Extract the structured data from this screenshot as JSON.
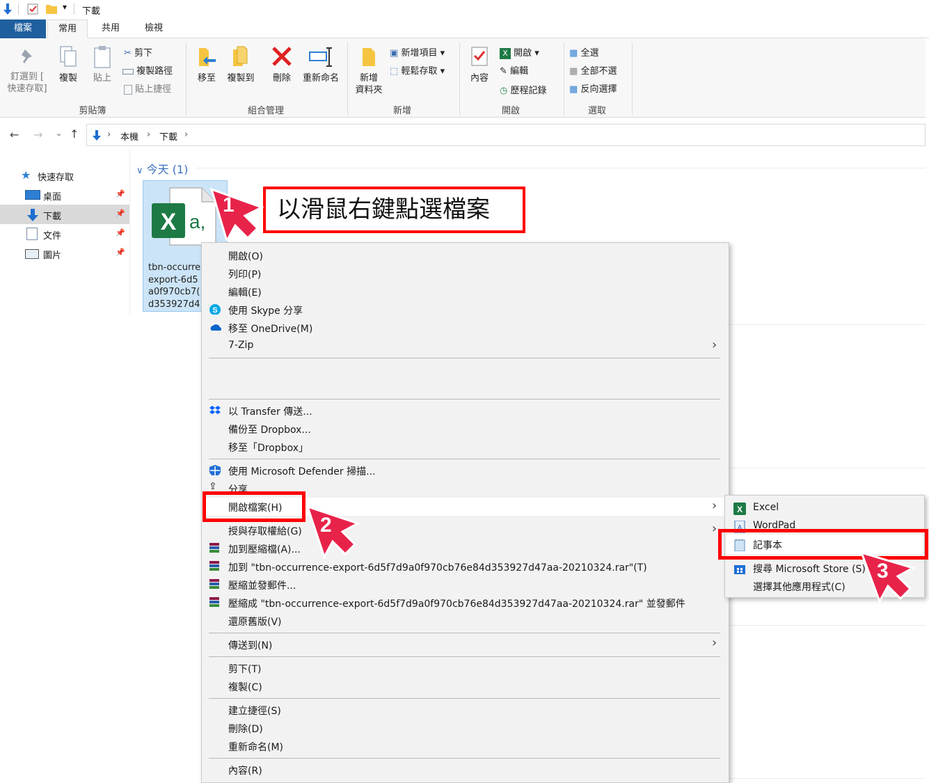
{
  "titlebar": {
    "title": "下載"
  },
  "tabs": [
    "檔案",
    "常用",
    "共用",
    "檢視"
  ],
  "ribbon": {
    "clipboard": {
      "pin_label_1": "釘選到 [",
      "pin_label_2": "快速存取]",
      "copy": "複製",
      "paste": "貼上",
      "cut": "剪下",
      "copy_path": "複製路徑",
      "paste_shortcut": "貼上捷徑",
      "group": "剪貼簿"
    },
    "organize": {
      "move_to": "移至",
      "copy_to": "複製到",
      "delete": "刪除",
      "rename": "重新命名",
      "group": "組合管理"
    },
    "new": {
      "new_folder_1": "新增",
      "new_folder_2": "資料夾",
      "new_item": "新增項目",
      "easy_access": "輕鬆存取",
      "group": "新增"
    },
    "open": {
      "properties": "內容",
      "open": "開啟",
      "edit": "編輯",
      "history": "歷程記錄",
      "group": "開啟"
    },
    "select": {
      "select_all": "全選",
      "select_none": "全部不選",
      "invert": "反向選擇",
      "group": "選取"
    }
  },
  "address": {
    "crumbs": [
      "本機",
      "下載"
    ]
  },
  "nav": [
    {
      "label": "快速存取"
    },
    {
      "label": "桌面"
    },
    {
      "label": "下載"
    },
    {
      "label": "文件"
    },
    {
      "label": "圖片"
    }
  ],
  "content": {
    "group_header": "今天 (1)",
    "file_name": "tbn-occurre\nexport-6d5\na0f970cb7(\nd353927d4"
  },
  "context_menu": {
    "open": "開啟(O)",
    "print": "列印(P)",
    "edit": "編輯(E)",
    "skype": "使用 Skype 分享",
    "onedrive": "移至 OneDrive(M)",
    "zip": "7-Zip",
    "transfer": "以 Transfer 傳送...",
    "dropbox_backup": "備份至 Dropbox...",
    "dropbox_move": "移至「Dropbox」",
    "defender": "使用 Microsoft Defender 掃描...",
    "share": "分享",
    "open_with": "開啟檔案(H)",
    "grant_access": "授與存取權給(G)",
    "add_archive": "加到壓縮檔(A)...",
    "add_rar": "加到 \"tbn-occurrence-export-6d5f7d9a0f970cb76e84d353927d47aa-20210324.rar\"(T)",
    "compress_email": "壓縮並發郵件...",
    "compress_rar_email": "壓縮成 \"tbn-occurrence-export-6d5f7d9a0f970cb76e84d353927d47aa-20210324.rar\" 並發郵件",
    "restore": "還原舊版(V)",
    "send_to": "傳送到(N)",
    "cut": "剪下(T)",
    "copy": "複製(C)",
    "create_shortcut": "建立捷徑(S)",
    "delete": "刪除(D)",
    "rename": "重新命名(M)",
    "properties": "內容(R)"
  },
  "submenu": {
    "excel": "Excel",
    "wordpad": "WordPad",
    "notepad": "記事本",
    "store": "搜尋 Microsoft Store (S)",
    "other": "選擇其他應用程式(C)"
  },
  "annotations": {
    "callout": "以滑鼠右鍵點選檔案",
    "step1": "1",
    "step2": "2",
    "step3": "3"
  },
  "colors": {
    "accent": "#1f5f9e",
    "annotation": "#ff0000",
    "badge": "#e8234a",
    "selection": "#cce4f7"
  }
}
